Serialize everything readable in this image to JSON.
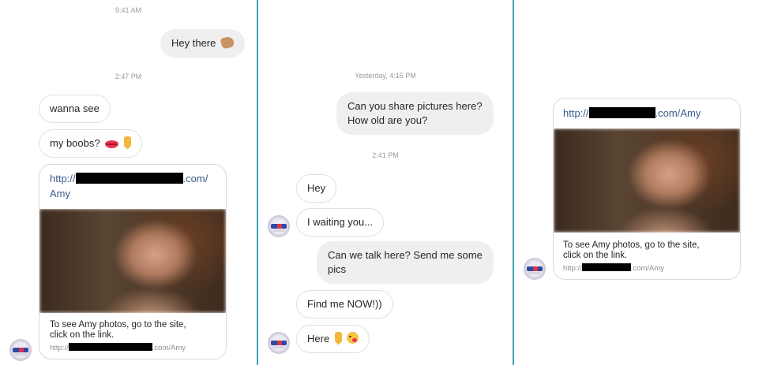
{
  "panel_left": {
    "timestamp_1": "9:41 AM",
    "sent_message": "Hey there",
    "sent_emoji": "waving-hand-icon",
    "timestamp_2": "2:47 PM",
    "received_1": "wanna see",
    "received_2": "my boobs?",
    "received_2_emojis": [
      "kiss-lips-icon",
      "pointing-down-icon"
    ],
    "card": {
      "link_prefix": "http://",
      "link_suffix": ".com/",
      "link_tail": "Amy",
      "caption_line1": "To see Amy photos, go to the site,",
      "caption_line2": "click on the link.",
      "small_prefix": "http://",
      "small_suffix": ".com/Amy"
    }
  },
  "panel_middle": {
    "timestamp_1": "Yesterday, 4:15 PM",
    "sent_line1": "Can you share pictures here?",
    "sent_line2": "How old are you?",
    "timestamp_2": "2:41 PM",
    "received_1": "Hey",
    "received_2": "I waiting you...",
    "sent_2_line1": "Can we talk here? Send me some",
    "sent_2_line2": "pics",
    "received_3": "Find me NOW!))",
    "received_4": "Here",
    "received_4_emojis": [
      "pointing-down-icon",
      "winking-kiss-icon"
    ]
  },
  "panel_right": {
    "card": {
      "link_prefix": "http://",
      "link_suffix": ".com/Amy",
      "caption_line1": "To see Amy photos, go to the site,",
      "caption_line2": "click on the link.",
      "small_prefix": "http://",
      "small_suffix": ".com/Amy"
    }
  },
  "colors": {
    "divider": "#3aa6b9",
    "outgoing_bubble": "#efefef",
    "link_text": "#3a5a8c",
    "timestamp": "#9a9a9a"
  }
}
